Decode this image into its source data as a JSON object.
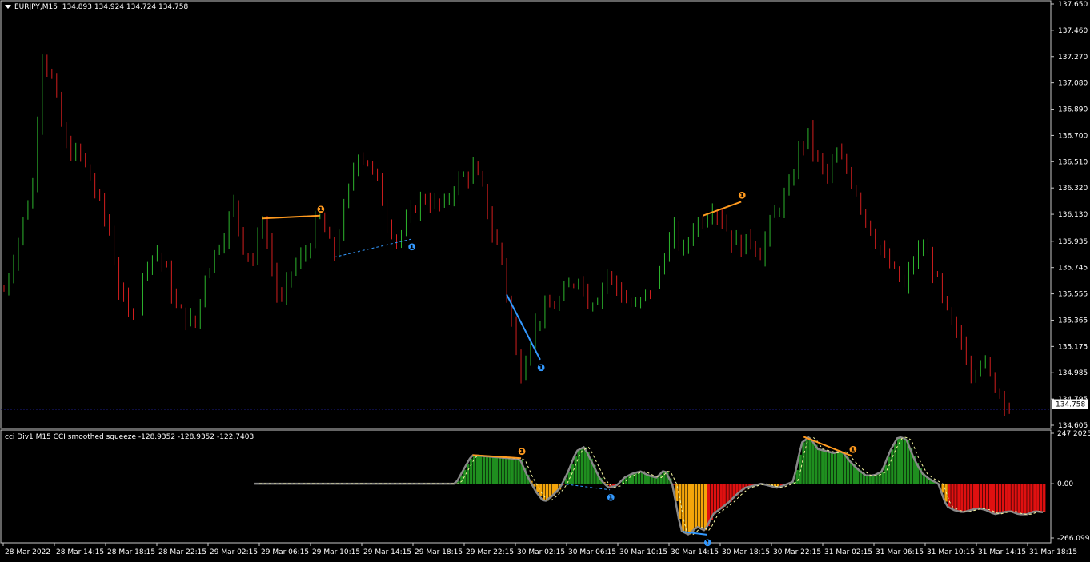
{
  "header": {
    "symbol_tf": "EURJPY,M15",
    "ohlc": "134.893 134.924 134.724 134.758",
    "indicator_title": "cci Div1 M15 CCI smoothed squeeze -128.9352 -128.9352 -122.7403"
  },
  "colors": {
    "background": "#000000",
    "bull": "#2db52d",
    "bear": "#d21e1e",
    "bull_hist": "#1f8f1f",
    "bear_hist": "#e01010",
    "squeeze": "#f5a50a",
    "bear_div": "#ff9a1f",
    "bull_div": "#3399ff",
    "grid": "#16166a",
    "axis": "#c8c8c8"
  },
  "chart_data": [
    {
      "type": "candlestick",
      "title": "EURJPY,M15",
      "y_ticks": [
        "137.650",
        "137.460",
        "137.270",
        "137.080",
        "136.890",
        "136.700",
        "136.510",
        "136.320",
        "136.130",
        "135.935",
        "135.745",
        "135.555",
        "135.365",
        "135.175",
        "134.985",
        "134.795",
        "134.605"
      ],
      "ylim": [
        134.605,
        137.65
      ],
      "current_price": "134.758",
      "x_ticks": [
        "28 Mar 2022",
        "28 Mar 14:15",
        "28 Mar 18:15",
        "28 Mar 22:15",
        "29 Mar 02:15",
        "29 Mar 06:15",
        "29 Mar 10:15",
        "29 Mar 14:15",
        "29 Mar 18:15",
        "29 Mar 22:15",
        "30 Mar 02:15",
        "30 Mar 06:15",
        "30 Mar 10:15",
        "30 Mar 14:15",
        "30 Mar 18:15",
        "30 Mar 22:15",
        "31 Mar 02:15",
        "31 Mar 06:15",
        "31 Mar 10:15",
        "31 Mar 14:15",
        "31 Mar 18:15"
      ],
      "close_path": [
        [
          0,
          135.58
        ],
        [
          3,
          135.95
        ],
        [
          6,
          136.35
        ],
        [
          8,
          137.3
        ],
        [
          10,
          137.1
        ],
        [
          13,
          136.6
        ],
        [
          16,
          136.55
        ],
        [
          19,
          136.3
        ],
        [
          22,
          136.0
        ],
        [
          24,
          135.6
        ],
        [
          26,
          135.4
        ],
        [
          28,
          135.5
        ],
        [
          30,
          135.82
        ],
        [
          32,
          135.85
        ],
        [
          34,
          135.7
        ],
        [
          36,
          135.45
        ],
        [
          38,
          135.38
        ],
        [
          40,
          135.33
        ],
        [
          42,
          135.7
        ],
        [
          44,
          135.85
        ],
        [
          46,
          136.0
        ],
        [
          48,
          136.2
        ],
        [
          50,
          135.9
        ],
        [
          52,
          135.8
        ],
        [
          54,
          136.1
        ],
        [
          56,
          135.75
        ],
        [
          57,
          135.55
        ],
        [
          58,
          135.5
        ],
        [
          60,
          135.72
        ],
        [
          63,
          135.85
        ],
        [
          65,
          136.05
        ],
        [
          66,
          136.1
        ],
        [
          68,
          135.9
        ],
        [
          69,
          135.85
        ],
        [
          72,
          136.3
        ],
        [
          74,
          136.6
        ],
        [
          76,
          136.5
        ],
        [
          78,
          136.35
        ],
        [
          80,
          136.1
        ],
        [
          82,
          135.95
        ],
        [
          84,
          136.05
        ],
        [
          86,
          136.2
        ],
        [
          88,
          136.25
        ],
        [
          90,
          136.2
        ],
        [
          92,
          136.18
        ],
        [
          94,
          136.35
        ],
        [
          96,
          136.4
        ],
        [
          98,
          136.45
        ],
        [
          100,
          136.3
        ],
        [
          102,
          136.0
        ],
        [
          104,
          135.8
        ],
        [
          105,
          135.55
        ],
        [
          106,
          135.35
        ],
        [
          107,
          135.1
        ],
        [
          108,
          135.0
        ],
        [
          110,
          135.25
        ],
        [
          112,
          135.4
        ],
        [
          114,
          135.45
        ],
        [
          116,
          135.5
        ],
        [
          118,
          135.6
        ],
        [
          120,
          135.7
        ],
        [
          122,
          135.5
        ],
        [
          124,
          135.55
        ],
        [
          126,
          135.7
        ],
        [
          128,
          135.6
        ],
        [
          130,
          135.5
        ],
        [
          132,
          135.45
        ],
        [
          134,
          135.55
        ],
        [
          136,
          135.6
        ],
        [
          138,
          135.85
        ],
        [
          140,
          136.0
        ],
        [
          142,
          135.85
        ],
        [
          144,
          136.05
        ],
        [
          146,
          136.1
        ],
        [
          148,
          136.2
        ],
        [
          150,
          136.1
        ],
        [
          152,
          135.95
        ],
        [
          154,
          135.9
        ],
        [
          156,
          135.95
        ],
        [
          158,
          135.85
        ],
        [
          160,
          136.05
        ],
        [
          162,
          136.2
        ],
        [
          164,
          136.3
        ],
        [
          166,
          136.6
        ],
        [
          168,
          136.7
        ],
        [
          170,
          136.5
        ],
        [
          172,
          136.4
        ],
        [
          174,
          136.55
        ],
        [
          176,
          136.45
        ],
        [
          178,
          136.3
        ],
        [
          180,
          136.1
        ],
        [
          182,
          135.95
        ],
        [
          184,
          135.8
        ],
        [
          186,
          135.7
        ],
        [
          188,
          135.6
        ],
        [
          190,
          135.8
        ],
        [
          192,
          135.9
        ],
        [
          194,
          135.75
        ],
        [
          196,
          135.5
        ],
        [
          198,
          135.3
        ],
        [
          200,
          135.2
        ],
        [
          202,
          135.0
        ],
        [
          204,
          135.1
        ],
        [
          206,
          134.95
        ],
        [
          208,
          134.85
        ],
        [
          210,
          134.75
        ]
      ],
      "bear_divergence_lines": [
        {
          "from": [
            54,
            136.1
          ],
          "to": [
            66,
            136.12
          ]
        },
        {
          "from": [
            146,
            136.12
          ],
          "to": [
            154,
            136.22
          ]
        }
      ],
      "bull_divergence_lines": [
        {
          "from": [
            69,
            135.82
          ],
          "to": [
            85,
            135.95
          ],
          "style": "dashed"
        },
        {
          "from": [
            105,
            135.55
          ],
          "to": [
            112,
            135.08
          ]
        }
      ]
    },
    {
      "type": "histogram",
      "title": "cci Div1 M15 CCI smoothed squeeze",
      "y_ticks": [
        "247.2025",
        "0.00",
        "-266.0998"
      ],
      "ylim": [
        -266.0998,
        247.2025
      ],
      "values_path": [
        [
          0,
          0
        ],
        [
          50,
          0
        ],
        [
          54,
          140
        ],
        [
          60,
          130
        ],
        [
          66,
          120
        ],
        [
          68,
          30
        ],
        [
          70,
          -40
        ],
        [
          72,
          -90
        ],
        [
          74,
          -60
        ],
        [
          76,
          -20
        ],
        [
          78,
          60
        ],
        [
          80,
          160
        ],
        [
          82,
          180
        ],
        [
          84,
          100
        ],
        [
          86,
          20
        ],
        [
          88,
          -20
        ],
        [
          90,
          -10
        ],
        [
          92,
          30
        ],
        [
          94,
          50
        ],
        [
          96,
          60
        ],
        [
          98,
          40
        ],
        [
          100,
          30
        ],
        [
          102,
          70
        ],
        [
          104,
          -10
        ],
        [
          106,
          -230
        ],
        [
          108,
          -250
        ],
        [
          110,
          -210
        ],
        [
          112,
          -230
        ],
        [
          114,
          -150
        ],
        [
          116,
          -120
        ],
        [
          118,
          -90
        ],
        [
          120,
          -50
        ],
        [
          122,
          -20
        ],
        [
          124,
          -10
        ],
        [
          126,
          0
        ],
        [
          128,
          -10
        ],
        [
          130,
          -20
        ],
        [
          132,
          -5
        ],
        [
          134,
          10
        ],
        [
          136,
          200
        ],
        [
          138,
          230
        ],
        [
          140,
          170
        ],
        [
          142,
          160
        ],
        [
          144,
          150
        ],
        [
          146,
          160
        ],
        [
          148,
          110
        ],
        [
          150,
          70
        ],
        [
          152,
          40
        ],
        [
          154,
          40
        ],
        [
          156,
          60
        ],
        [
          158,
          160
        ],
        [
          160,
          230
        ],
        [
          162,
          220
        ],
        [
          164,
          120
        ],
        [
          166,
          50
        ],
        [
          168,
          20
        ],
        [
          170,
          0
        ],
        [
          172,
          -110
        ],
        [
          174,
          -130
        ],
        [
          176,
          -140
        ],
        [
          178,
          -130
        ],
        [
          180,
          -120
        ],
        [
          182,
          -130
        ],
        [
          184,
          -150
        ],
        [
          186,
          -140
        ],
        [
          188,
          -135
        ],
        [
          190,
          -150
        ],
        [
          192,
          -150
        ],
        [
          194,
          -135
        ],
        [
          196,
          -140
        ]
      ],
      "squeeze_ranges": [
        [
          68,
          76
        ],
        [
          86,
          88
        ],
        [
          104,
          112
        ],
        [
          126,
          130
        ],
        [
          170,
          172
        ]
      ],
      "x_span": [
        0,
        196
      ]
    }
  ]
}
